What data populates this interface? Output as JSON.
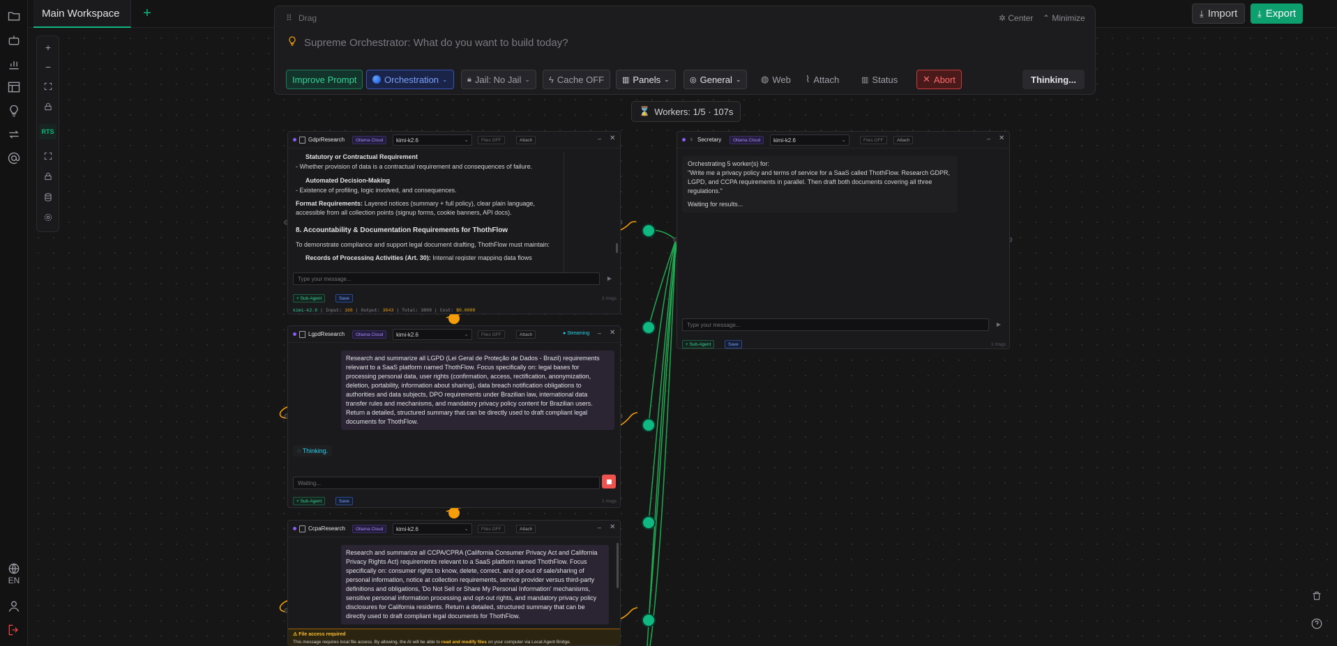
{
  "app": {
    "workspace_tab": "Main Workspace",
    "add_tab": "+",
    "import_label": "Import",
    "export_label": "Export",
    "language": "EN",
    "colors": {
      "accent": "#10b981",
      "danger": "#ef4444",
      "bubble": "#2a2433"
    }
  },
  "sidebar": {
    "icons": [
      "folder-icon",
      "robot-icon",
      "bar-chart-icon",
      "layout-icon",
      "lightbulb-icon",
      "swap-icon",
      "at-sign-icon",
      "globe-icon",
      "user-icon",
      "logout-icon"
    ]
  },
  "zoombar": {
    "icons": [
      "zoom-in-icon",
      "zoom-out-icon",
      "fit-view-icon",
      "lock-icon",
      "rts-toggle",
      "fullscreen-icon",
      "lock-icon",
      "database-icon",
      "settings-icon"
    ],
    "rts_label": "RTS"
  },
  "prompt": {
    "drag_label": "Drag",
    "center_label": "Center",
    "minimize_label": "Minimize",
    "placeholder": "Supreme Orchestrator: What do you want to build today?",
    "buttons": {
      "improve": "Improve Prompt",
      "orchestration": "Orchestration",
      "jail": "Jail: No Jail",
      "cache": "Cache OFF",
      "panels": "Panels",
      "general": "General",
      "web": "Web",
      "attach": "Attach",
      "status": "Status",
      "abort": "Abort",
      "thinking": "Thinking..."
    }
  },
  "workers_badge": "Workers: 1/5 · 107s",
  "panels": {
    "gdpr": {
      "name": "GdprResearch",
      "provider": "Ollama Cloud",
      "model": "kimi-k2.6",
      "files": "Files OFF",
      "attach": "Attach",
      "content": {
        "h1": "Statutory or Contractual Requirement",
        "p1": "- Whether provision of data is a contractual requirement and consequences of failure.",
        "h2": "Automated Decision-Making",
        "p2": "- Existence of profiling, logic involved, and consequences.",
        "fmt_label": "Format Requirements:",
        "fmt_text": " Layered notices (summary + full policy), clear plain language, accessible from all collection points (signup forms, cookie banners, API docs).",
        "section": "8. Accountability & Documentation Requirements for ThothFlow",
        "p3": "To demonstrate compliance and support legal document drafting, ThothFlow must maintain:",
        "p4_label": "Records of Processing Activities (Art. 30):",
        "p4_text": " Internal register mapping data flows"
      },
      "input_placeholder": "Type your message...",
      "sub_agent": "+ Sub-Agent",
      "save": "Save",
      "msg_count": "2 msgs",
      "stats": {
        "model": "kimi-k2.6",
        "input_label": "Input:",
        "input": "166",
        "output_label": "Output:",
        "output": "3643",
        "total_label": "Total:",
        "total": "3809",
        "cost_label": "Cost:",
        "cost": "$0.0000"
      }
    },
    "lgpd": {
      "name": "LgpdResearch",
      "provider": "Ollama Cloud",
      "model": "kimi-k2.6",
      "files": "Files OFF",
      "attach": "Attach",
      "streaming": "Streaming",
      "message": "Research and summarize all LGPD (Lei Geral de Proteção de Dados - Brazil) requirements relevant to a SaaS platform named ThothFlow. Focus specifically on: legal bases for processing personal data, user rights (confirmation, access, rectification, anonymization, deletion, portability, information about sharing), data breach notification obligations to authorities and data subjects, DPO requirements under Brazilian law, international data transfer rules and mechanisms, and mandatory privacy policy content for Brazilian users. Return a detailed, structured summary that can be directly used to draft compliant legal documents for ThothFlow.",
      "thinking": "Thinking.",
      "input_placeholder": "Waiting...",
      "sub_agent": "+ Sub-Agent",
      "save": "Save",
      "msg_count": "1 msgs"
    },
    "ccpa": {
      "name": "CcpaResearch",
      "provider": "Ollama Cloud",
      "model": "kimi-k2.6",
      "files": "Files OFF",
      "attach": "Attach",
      "message": "Research and summarize all CCPA/CPRA (California Consumer Privacy Act and California Privacy Rights Act) requirements relevant to a SaaS platform named ThothFlow. Focus specifically on: consumer rights to know, delete, correct, and opt-out of sale/sharing of personal information, notice at collection requirements, service provider versus third-party definitions and obligations, 'Do Not Sell or Share My Personal Information' mechanisms, sensitive personal information processing and opt-out rights, and mandatory privacy policy disclosures for California residents. Return a detailed, structured summary that can be directly used to draft compliant legal documents for ThothFlow.",
      "file_access_title": "File access required",
      "file_access_text_a": "This message requires local file access. By allowing, the AI will be able to ",
      "file_access_link": "read and modify files",
      "file_access_text_b": " on your computer via Local Agent Bridge."
    },
    "secretary": {
      "name": "Secretary",
      "provider": "Ollama Cloud",
      "model": "kimi-k2.6",
      "files": "Files OFF",
      "attach": "Attach",
      "line1": "Orchestrating 5 worker(s) for:",
      "line2": "\"Write me a privacy policy and terms of service for a SaaS called ThothFlow. Research GDPR, LGPD, and CCPA requirements in parallel. Then draft both documents covering all three regulations.\"",
      "line3": "Waiting for results...",
      "input_placeholder": "Type your message...",
      "sub_agent": "+ Sub-Agent",
      "save": "Save",
      "msg_count": "1 msgs"
    }
  }
}
